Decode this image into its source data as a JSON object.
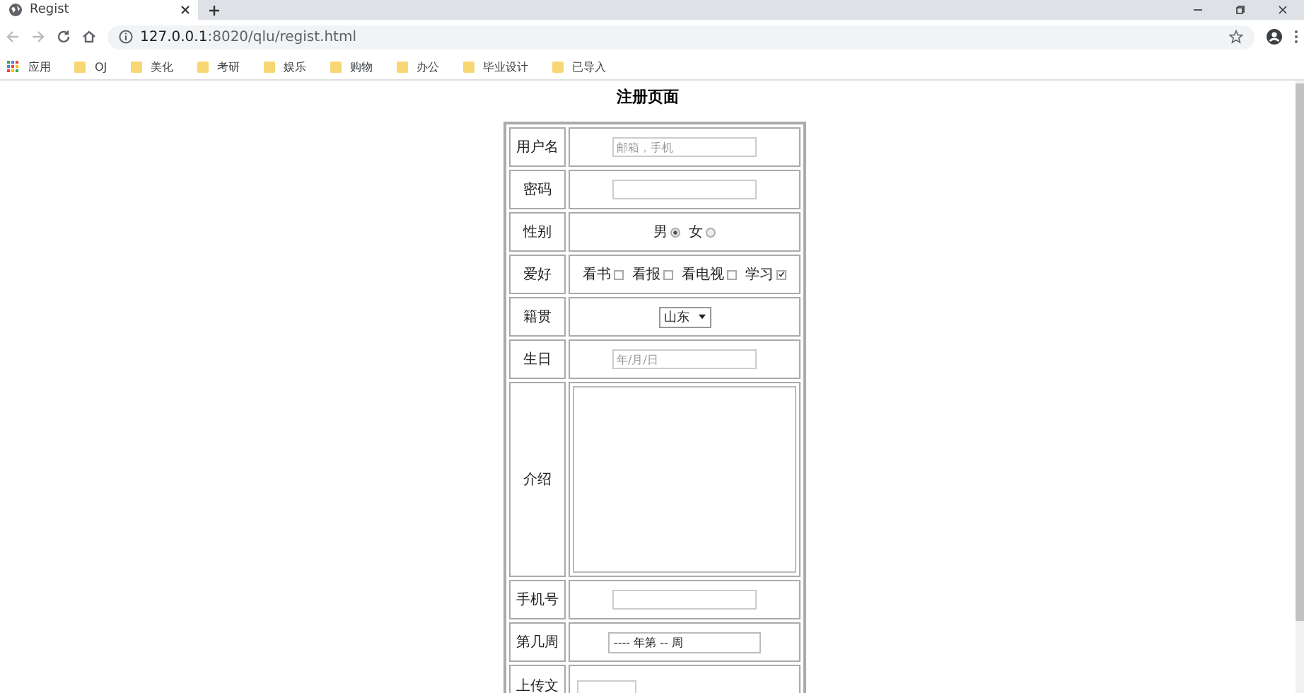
{
  "browser": {
    "tab_title": "Regist",
    "url_host": "127.0.0.1",
    "url_path": ":8020/qlu/regist.html",
    "bookmarks": [
      {
        "label": "应用",
        "kind": "apps"
      },
      {
        "label": "OJ",
        "kind": "folder"
      },
      {
        "label": "美化",
        "kind": "folder"
      },
      {
        "label": "考研",
        "kind": "folder"
      },
      {
        "label": "娱乐",
        "kind": "folder"
      },
      {
        "label": "购物",
        "kind": "folder"
      },
      {
        "label": "办公",
        "kind": "folder"
      },
      {
        "label": "毕业设计",
        "kind": "folder"
      },
      {
        "label": "已导入",
        "kind": "folder"
      }
    ]
  },
  "page": {
    "title": "注册页面",
    "rows": [
      {
        "label": "用户名",
        "kind": "text",
        "placeholder": "邮箱，手机"
      },
      {
        "label": "密码",
        "kind": "text"
      },
      {
        "label": "性别",
        "kind": "radio",
        "options": [
          {
            "label": "男",
            "selected": true
          },
          {
            "label": "女",
            "selected": false
          }
        ]
      },
      {
        "label": "爱好",
        "kind": "checkbox",
        "options": [
          {
            "label": "看书",
            "checked": false
          },
          {
            "label": "看报",
            "checked": false
          },
          {
            "label": "看电视",
            "checked": false
          },
          {
            "label": "学习",
            "checked": true
          }
        ]
      },
      {
        "label": "籍贯",
        "kind": "select",
        "value": "山东"
      },
      {
        "label": "生日",
        "kind": "date",
        "placeholder": "年/月/日"
      },
      {
        "label": "介绍",
        "kind": "textarea"
      },
      {
        "label": "手机号",
        "kind": "text"
      },
      {
        "label": "第几周",
        "kind": "week",
        "value": "---- 年第 -- 周"
      },
      {
        "label": "上传文",
        "kind": "file"
      }
    ]
  }
}
